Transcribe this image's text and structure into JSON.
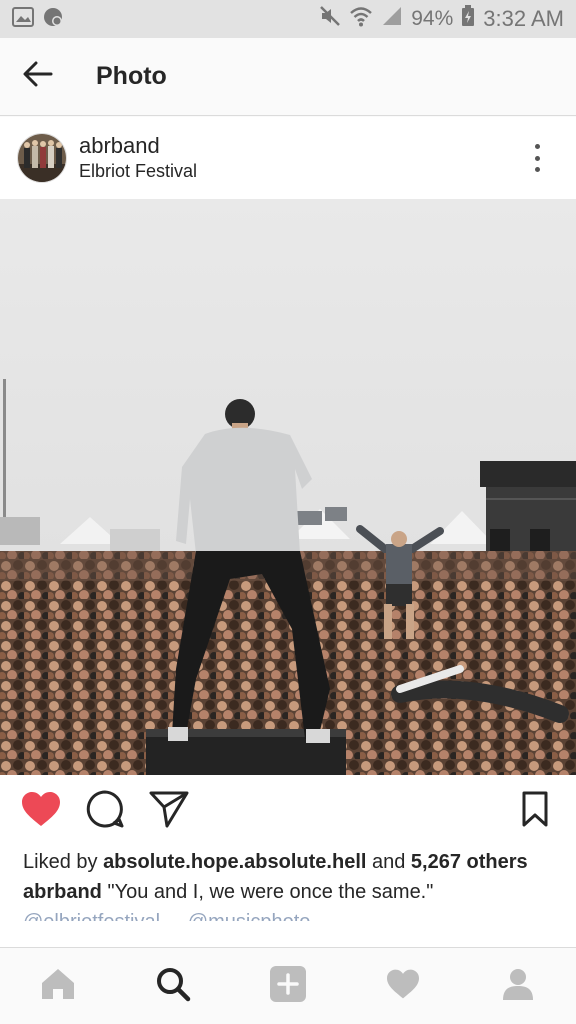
{
  "status_bar": {
    "battery": "94%",
    "time": "3:32 AM",
    "icons": [
      "image-icon",
      "chat-icon",
      "mute-icon",
      "wifi-icon",
      "signal-icon",
      "battery-icon"
    ]
  },
  "header": {
    "title": "Photo",
    "back_icon": "arrow-left-icon"
  },
  "post": {
    "username": "abrband",
    "location": "Elbriot Festival",
    "more_icon": "vertical-ellipsis-icon",
    "photo_alt": "Singer on stage in front of festival crowd",
    "likes_prefix": "Liked by ",
    "liked_by_user": "absolute.hope.absolute.hell",
    "likes_conjunction": " and ",
    "likes_count": "5,267",
    "likes_suffix": "others",
    "caption_user": "abrband",
    "caption_text": " \"You and I, we were once the same.\"",
    "comment_peek": "@elbriotfestival  ...  @musicphoto ..."
  },
  "actions": {
    "like_icon": "heart-filled-icon",
    "comment_icon": "comment-icon",
    "share_icon": "paper-plane-icon",
    "save_icon": "bookmark-icon",
    "like_color": "#ed4956"
  },
  "bottom_nav": {
    "items": [
      "home-icon",
      "search-icon",
      "add-post-icon",
      "activity-icon",
      "profile-icon"
    ],
    "active": "search-icon"
  }
}
